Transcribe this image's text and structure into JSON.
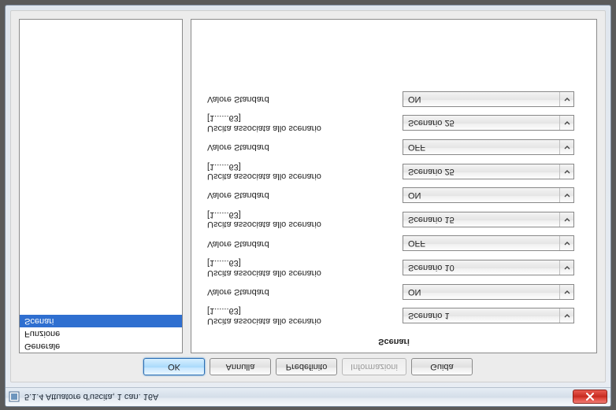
{
  "window": {
    "title": "5.1.4 Attuatore d'uscita, 1 can. 16A",
    "close_label": "×"
  },
  "buttons": {
    "ok": "OK",
    "cancel": "Annulla",
    "default": "Predefinito",
    "info": "Informazioni",
    "help": "Guida"
  },
  "sidebar": {
    "items": [
      {
        "label": "Generale"
      },
      {
        "label": "Funzione"
      },
      {
        "label": "Scenari",
        "selected": true
      }
    ]
  },
  "panel": {
    "title": "Scenari",
    "rangeText": "[1......63]",
    "rows": [
      {
        "label": "Uscita associata allo scenario",
        "range": true,
        "value": "Scenario 1"
      },
      {
        "label": "Valore Standard",
        "value": "ON"
      },
      {
        "label": "Uscita associata allo scenario",
        "range": true,
        "value": "Scenario 10"
      },
      {
        "label": "Valore Standard",
        "value": "OFF"
      },
      {
        "label": "Uscita associata allo scenario",
        "range": true,
        "value": "Scenario 15"
      },
      {
        "label": "Valore Standard",
        "value": "ON"
      },
      {
        "label": "Uscita associata allo scenario",
        "range": true,
        "value": "Scenario 25"
      },
      {
        "label": "Valore Standard",
        "value": "OFF"
      },
      {
        "label": "Uscita associata allo scenario",
        "range": true,
        "value": "Scenario 25"
      },
      {
        "label": "Valore Standard",
        "value": "ON"
      }
    ]
  }
}
